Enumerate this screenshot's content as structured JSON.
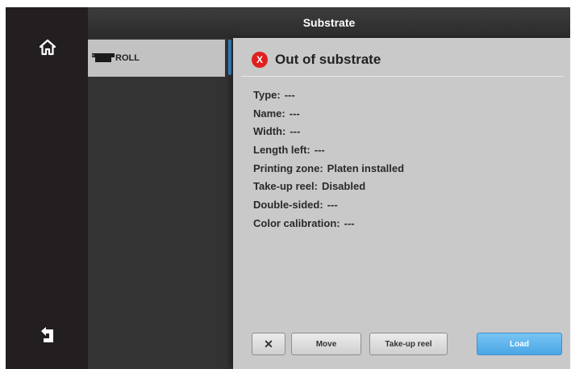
{
  "title": "Substrate",
  "list": {
    "items": [
      {
        "label": "ROLL",
        "icon": "roll-icon"
      }
    ]
  },
  "status": {
    "icon": "error-icon",
    "icon_text": "X",
    "title": "Out of substrate",
    "color": "#e02020"
  },
  "properties": [
    {
      "label": "Type:",
      "value": "---"
    },
    {
      "label": "Name:",
      "value": "---"
    },
    {
      "label": "Width:",
      "value": "---"
    },
    {
      "label": "Length left:",
      "value": "---"
    },
    {
      "label": "Printing zone:",
      "value": "Platen installed"
    },
    {
      "label": "Take-up reel:",
      "value": "Disabled"
    },
    {
      "label": "Double-sided:",
      "value": "---"
    },
    {
      "label": "Color calibration:",
      "value": "---"
    }
  ],
  "buttons": {
    "cut": "✕",
    "move": "Move",
    "takeup": "Take-up reel",
    "load": "Load"
  },
  "colors": {
    "accent": "#4aa6e4",
    "nav_bg": "#231f20",
    "panel_bg": "#c9c9c9"
  }
}
